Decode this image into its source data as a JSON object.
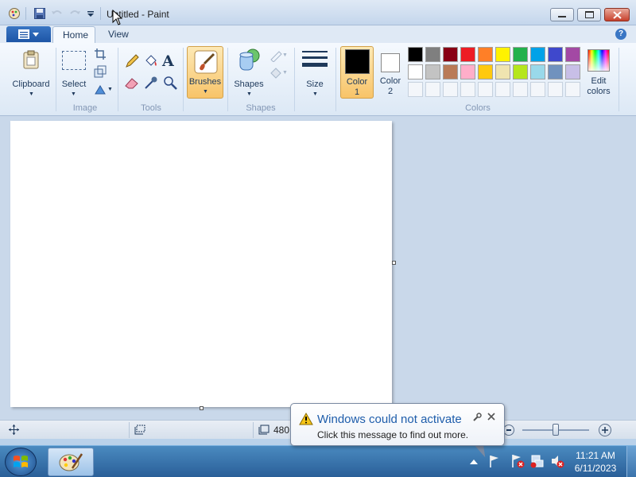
{
  "window": {
    "title": "Untitled - Paint"
  },
  "ribbon": {
    "tabs": [
      "Home",
      "View"
    ],
    "groups": {
      "clipboard": {
        "label": "Clipboard"
      },
      "image": {
        "label": "Image",
        "select_label": "Select"
      },
      "tools": {
        "label": "Tools"
      },
      "brushes": {
        "label": "Brushes"
      },
      "shapes": {
        "label": "Shapes",
        "shapes_button": "Shapes"
      },
      "size": {
        "label": "Size"
      },
      "color1": {
        "line1": "Color",
        "line2": "1"
      },
      "color2": {
        "line1": "Color",
        "line2": "2"
      },
      "colors": {
        "label": "Colors",
        "edit_line1": "Edit",
        "edit_line2": "colors"
      }
    },
    "help_glyph": "?",
    "palette_row1": [
      "#000000",
      "#7f7f7f",
      "#880015",
      "#ed1c24",
      "#ff7f27",
      "#fff200",
      "#22b14c",
      "#00a2e8",
      "#3f48cc",
      "#a349a4"
    ],
    "palette_row2": [
      "#ffffff",
      "#c3c3c3",
      "#b97a57",
      "#ffaec9",
      "#ffc90e",
      "#efe4b0",
      "#b5e61d",
      "#99d9ea",
      "#7092be",
      "#c8bfe7"
    ],
    "color1_value": "#000000",
    "color2_value": "#ffffff"
  },
  "statusbar": {
    "canvas_size": "480"
  },
  "notification": {
    "title": "Windows could not activate",
    "message": "Click this message to find out more.",
    "icon": "warning-icon"
  },
  "taskbar": {
    "time": "11:21 AM",
    "date": "6/11/2023"
  }
}
